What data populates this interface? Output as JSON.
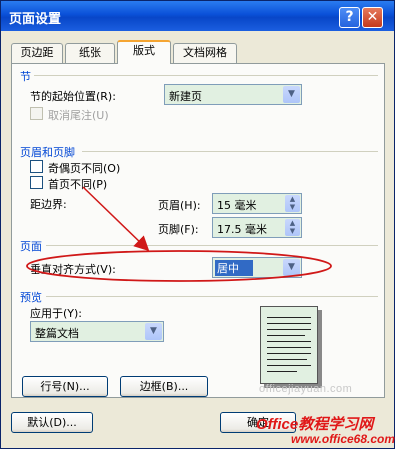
{
  "window": {
    "title": "页面设置"
  },
  "tabs": [
    {
      "label": "页边距",
      "active": false
    },
    {
      "label": "纸张",
      "active": false
    },
    {
      "label": "版式",
      "active": true
    },
    {
      "label": "文档网格",
      "active": false
    }
  ],
  "section": {
    "title": "节",
    "start_label": "节的起始位置(R):",
    "start_value": "新建页",
    "suppress_endnotes_label": "取消尾注(U)"
  },
  "headers_footers": {
    "title": "页眉和页脚",
    "odd_even_label": "奇偶页不同(O)",
    "first_page_label": "首页不同(P)",
    "from_edge_label": "距边界:",
    "header_label": "页眉(H):",
    "header_value": "15 毫米",
    "footer_label": "页脚(F):",
    "footer_value": "17.5 毫米"
  },
  "page": {
    "title": "页面",
    "valign_label": "垂直对齐方式(V):",
    "valign_value": "居中"
  },
  "preview": {
    "title": "预览",
    "apply_to_label": "应用于(Y):",
    "apply_to_value": "整篇文档"
  },
  "buttons": {
    "line_numbers": "行号(N)...",
    "borders": "边框(B)...",
    "default": "默认(D)...",
    "ok": "确定"
  },
  "watermark": {
    "site": "officejiayuan.com",
    "logo": "Office教程学习网",
    "url": "www.office68.com"
  },
  "annotation_color": "#d01818"
}
